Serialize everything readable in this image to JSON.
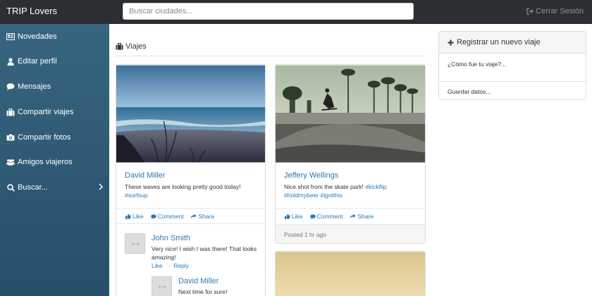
{
  "navbar": {
    "brand": "TRIP Lovers",
    "search_placeholder": "Buscar ciudades...",
    "logout_label": "Cerrar Sesión"
  },
  "sidebar": {
    "items": [
      {
        "label": "Novedades",
        "icon": "newspaper-icon"
      },
      {
        "label": "Editar perfil",
        "icon": "user-icon"
      },
      {
        "label": "Mensajes",
        "icon": "chat-icon"
      },
      {
        "label": "Compartir viajes",
        "icon": "suitcase-icon"
      },
      {
        "label": "Compartir fotos",
        "icon": "camera-icon"
      },
      {
        "label": "Amigos viajeros",
        "icon": "users-icon"
      },
      {
        "label": "Buscar...",
        "icon": "search-icon"
      }
    ]
  },
  "main": {
    "section_title": "Viajes",
    "posts": [
      {
        "author": "David Miller",
        "text": "These waves are looking pretty good today!",
        "hashtags": "#surfsup",
        "actions": {
          "like": "Like",
          "comment": "Comment",
          "share": "Share"
        },
        "comments": [
          {
            "author": "John Smith",
            "text_line1": "Very nice! I wish I was there! That looks",
            "text_line2": "amazing!",
            "like": "Like",
            "separator": "·",
            "reply": "Reply"
          },
          {
            "author": "David Miller",
            "text": "Next time for sure!"
          }
        ]
      },
      {
        "author": "Jeffery Wellings",
        "text": "Nice shot from the skate park!",
        "hashtag_inline": "#kickflip",
        "hashtags": "#holdmybeer #igotthis",
        "actions": {
          "like": "Like",
          "comment": "Comment",
          "share": "Share"
        },
        "posted": "Posted 1 hr ago"
      }
    ]
  },
  "panel": {
    "title": "Registrar un nuevo viaje",
    "question_placeholder": "¿Cómo fue tu viaje?...",
    "save_label": "Guardar datos..."
  },
  "colors": {
    "navbar_bg": "#2b2f33",
    "sidebar_bg": "#2f5d78",
    "link": "#2a79b8"
  }
}
